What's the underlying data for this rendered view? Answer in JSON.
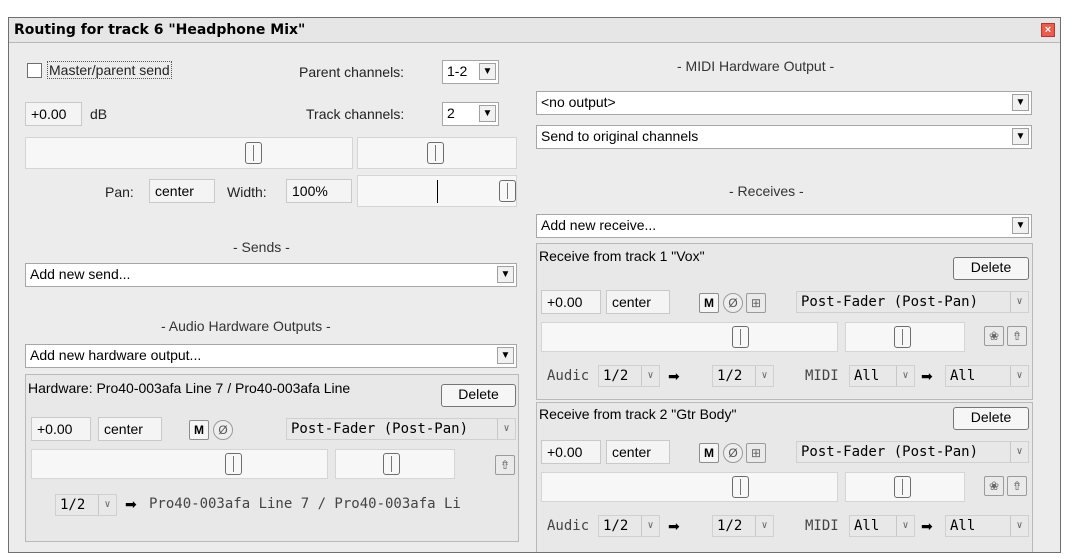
{
  "window": {
    "title": "Routing for track 6 \"Headphone Mix\"",
    "close_glyph": "×"
  },
  "left": {
    "master_send_label": "Master/parent send",
    "master_send_checked": false,
    "parent_channels_label": "Parent channels:",
    "parent_channels_value": "1-2",
    "volume_value": "+0.00",
    "volume_unit": "dB",
    "track_channels_label": "Track channels:",
    "track_channels_value": "2",
    "pan_label": "Pan:",
    "pan_value": "center",
    "width_label": "Width:",
    "width_value": "100%",
    "sends_header": "- Sends -",
    "add_send_placeholder": "Add new send...",
    "audio_hw_header": "- Audio Hardware Outputs -",
    "add_hw_placeholder": "Add new hardware output...",
    "hardware": {
      "label": "Hardware: Pro40-003afa Line 7 / Pro40-003afa Line",
      "delete_label": "Delete",
      "volume": "+0.00",
      "pan": "center",
      "mute_label": "M",
      "phase_glyph": "Ø",
      "mode": "Post-Fader (Post-Pan)",
      "src_channels": "1/2",
      "arrow": "➡",
      "dest": "Pro40-003afa Line 7 / Pro40-003afa Li"
    }
  },
  "right": {
    "midi_hw_header": "- MIDI Hardware Output -",
    "midi_output_value": "<no output>",
    "midi_channel_value": "Send to original channels",
    "receives_header": "- Receives -",
    "add_receive_placeholder": "Add new receive...",
    "receives": [
      {
        "label": "Receive from track 1 \"Vox\"",
        "delete_label": "Delete",
        "volume": "+0.00",
        "pan": "center",
        "mute_label": "M",
        "phase_glyph": "Ø",
        "mode": "Post-Fader (Post-Pan)",
        "audio_label": "Audic",
        "src_channels": "1/2",
        "dest_channels": "1/2",
        "arrow": "➡",
        "midi_label": "MIDI",
        "midi_src": "All",
        "midi_dest": "All"
      },
      {
        "label": "Receive from track 2 \"Gtr Body\"",
        "delete_label": "Delete",
        "volume": "+0.00",
        "pan": "center",
        "mute_label": "M",
        "phase_glyph": "Ø",
        "mode": "Post-Fader (Post-Pan)",
        "audio_label": "Audic",
        "src_channels": "1/2",
        "dest_channels": "1/2",
        "arrow": "➡",
        "midi_label": "MIDI",
        "midi_src": "All",
        "midi_dest": "All"
      }
    ]
  },
  "icons": {
    "dropdown": "▼",
    "dropdown_light": "∨",
    "mono_icon": "⊞",
    "midi_icon": "❀",
    "env_icon": "⇮"
  },
  "colors": {
    "window_bg": "#ececec",
    "close_red": "#ef5a4b",
    "groupbox_bg": "#e8e8e8"
  }
}
